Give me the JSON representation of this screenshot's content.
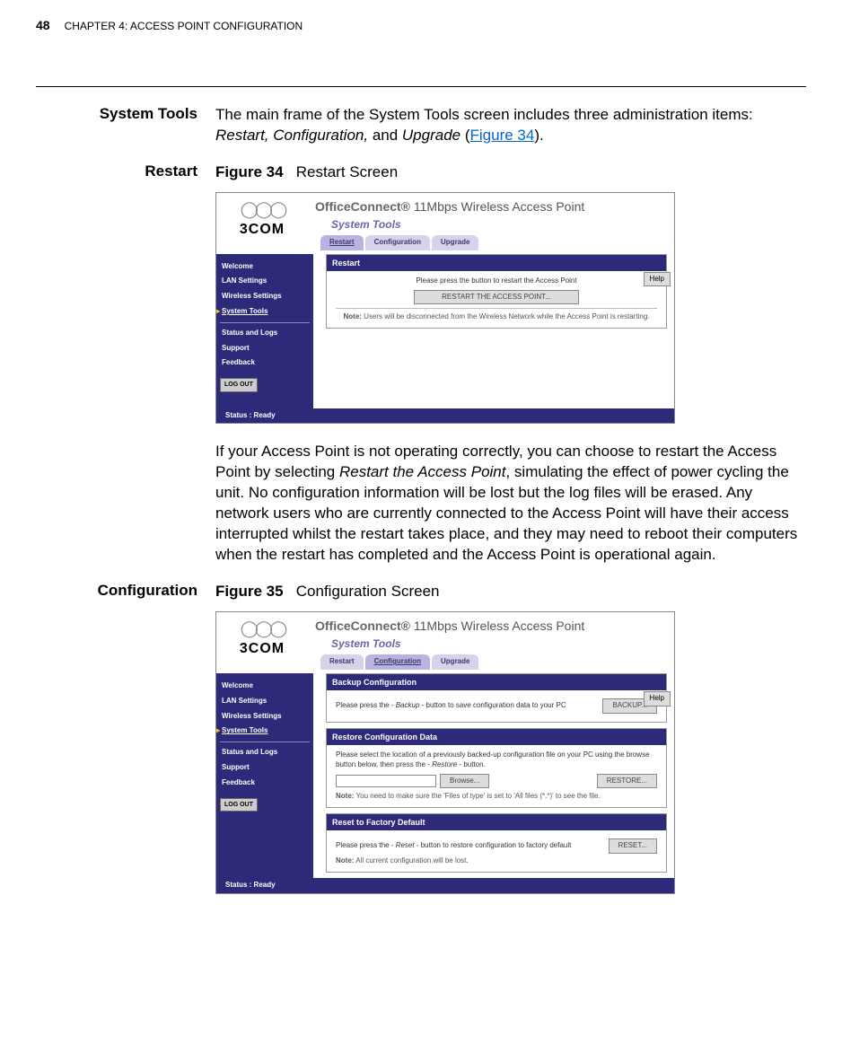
{
  "header": {
    "page_number": "48",
    "chapter": "CHAPTER 4: ACCESS POINT CONFIGURATION"
  },
  "section": {
    "title": "System Tools",
    "intro_a": "The main frame of the System Tools screen includes three administration items: ",
    "intro_items": "Restart, Configuration,",
    "intro_b": " and ",
    "intro_upgrade": "Upgrade",
    "intro_c": " (",
    "intro_link": "Figure 34",
    "intro_d": ")."
  },
  "restart": {
    "heading": "Restart",
    "fig_label": "Figure 34",
    "fig_caption": "Restart Screen",
    "body": "If your Access Point is not operating correctly, you can choose to restart the Access Point by selecting ",
    "body_italic": "Restart the Access Point",
    "body2": ", simulating the effect of power cycling the unit. No configuration information will be lost but the log files will be erased. Any network users who are currently connected to the Access Point will have their access interrupted whilst the restart takes place, and they may need to reboot their computers when the restart has completed and the Access Point is operational again."
  },
  "config": {
    "heading": "Configuration",
    "fig_label": "Figure 35",
    "fig_caption": "Configuration Screen"
  },
  "ui_common": {
    "logo_text": "3COM",
    "product_brand": "OfficeConnect®",
    "product_desc": "11Mbps Wireless Access Point",
    "subtitle": "System Tools",
    "nav": {
      "welcome": "Welcome",
      "lan": "LAN Settings",
      "wireless": "Wireless Settings",
      "systools": "System Tools",
      "status": "Status and Logs",
      "support": "Support",
      "feedback": "Feedback"
    },
    "logout": "LOG OUT",
    "tabs": {
      "restart": "Restart",
      "config": "Configuration",
      "upgrade": "Upgrade"
    },
    "help": "Help",
    "status_bar": "Status : Ready"
  },
  "ui_restart": {
    "panel_title": "Restart",
    "msg": "Please press the button to restart the Access Point",
    "button": "RESTART THE ACCESS POINT...",
    "note_label": "Note:",
    "note": " Users will be disconnected from the Wireless Network while the Access Point is restarting."
  },
  "ui_config": {
    "backup_title": "Backup Configuration",
    "backup_msg_a": "Please press the - ",
    "backup_msg_i": "Backup",
    "backup_msg_b": " - button to save configuration data to your PC",
    "backup_btn": "BACKUP...",
    "restore_title": "Restore Configuration Data",
    "restore_msg_a": "Please select the location of a previously backed-up configuration file on your PC using the browse button below, then press the - ",
    "restore_msg_i": "Restore",
    "restore_msg_b": " - button.",
    "browse_btn": "Browse...",
    "restore_btn": "RESTORE...",
    "restore_note_label": "Note:",
    "restore_note": " You need to make sure the 'Files of type' is set to 'All files (*.*)' to see the file.",
    "reset_title": "Reset to Factory Default",
    "reset_msg_a": "Please press the - ",
    "reset_msg_i": "Reset",
    "reset_msg_b": " - button to restore configuration to factory default",
    "reset_btn": "RESET...",
    "reset_note_label": "Note:",
    "reset_note": " All current configuration will be lost."
  }
}
